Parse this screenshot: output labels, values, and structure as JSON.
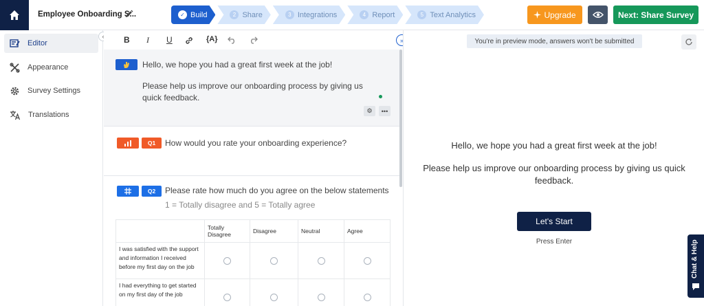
{
  "header": {
    "survey_title": "Employee Onboarding S...",
    "steps": [
      {
        "num": "1",
        "label": "Build",
        "active": true
      },
      {
        "num": "2",
        "label": "Share",
        "active": false
      },
      {
        "num": "3",
        "label": "Integrations",
        "active": false
      },
      {
        "num": "4",
        "label": "Report",
        "active": false
      },
      {
        "num": "5",
        "label": "Text Analytics",
        "active": false
      }
    ],
    "upgrade_label": "Upgrade",
    "next_label": "Next: Share Survey"
  },
  "sidebar": {
    "items": [
      {
        "label": "Editor",
        "icon": "editor-icon",
        "active": true
      },
      {
        "label": "Appearance",
        "icon": "appearance-icon",
        "active": false
      },
      {
        "label": "Survey Settings",
        "icon": "gear-icon",
        "active": false
      },
      {
        "label": "Translations",
        "icon": "translate-icon",
        "active": false
      }
    ]
  },
  "toolbar": {
    "bold": "B",
    "italic": "I",
    "underline": "U",
    "variable": "{A}"
  },
  "editor": {
    "welcome": {
      "title": "Hello, we hope you had a great first week at the job!",
      "subtitle": "Please help us improve our onboarding process by giving us quick feedback."
    },
    "q1": {
      "tag": "Q1",
      "text": "How would you rate your onboarding experience?"
    },
    "q2": {
      "tag": "Q2",
      "text": "Please rate how much do you agree on the below statements",
      "scale": "1 = Totally disagree and 5 = Totally agree",
      "columns": [
        "Totally Disagree",
        "Disagree",
        "Neutral",
        "Agree"
      ],
      "rows": [
        "I was satisfied with the support and information I received before my first day on the job",
        "I had everything to get started on my first day of the job"
      ]
    }
  },
  "preview": {
    "notice": "You're in preview mode, answers won't be submitted",
    "title": "Hello, we hope you had a great first week at the job!",
    "subtitle": "Please help us improve our onboarding process by giving us quick feedback.",
    "start_label": "Let's Start",
    "press_enter": "Press Enter"
  },
  "chat": {
    "label": "Chat & Help"
  },
  "colors": {
    "navy": "#0f2146",
    "primary": "#1d5fce",
    "upgrade": "#f7971e",
    "next": "#16985a"
  }
}
